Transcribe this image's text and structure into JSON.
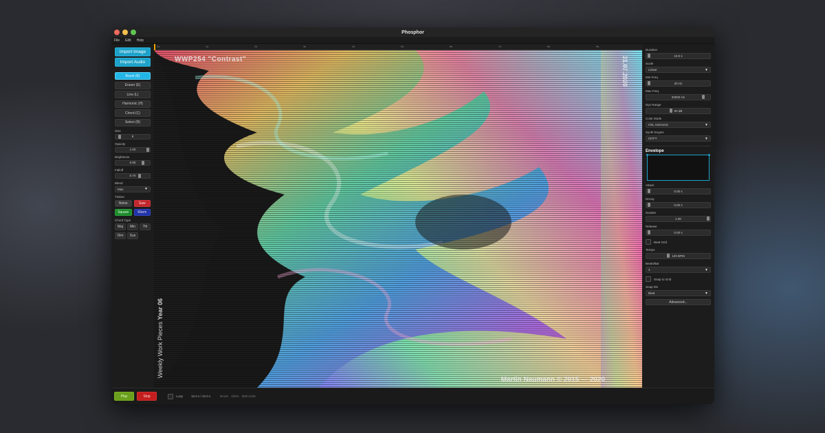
{
  "window": {
    "title": "Phosphor"
  },
  "menu": [
    "File",
    "Edit",
    "Help"
  ],
  "left": {
    "import_image": "Import Image",
    "import_audio": "Import Audio",
    "tools": [
      "Brush (B)",
      "Eraser (E)",
      "Line (L)",
      "Harmonic (H)",
      "Chord (C)",
      "Select (R)"
    ],
    "active_tool": "Brush (B)",
    "size": {
      "label": "Size",
      "value": "8"
    },
    "opacity": {
      "label": "Opacity",
      "value": "1.00"
    },
    "brightness": {
      "label": "Brightness",
      "value": "0.80"
    },
    "falloff": {
      "label": "Falloff",
      "value": "0.70"
    },
    "blend": {
      "label": "Blend",
      "value": "Max"
    },
    "timbre": {
      "label": "Timbre",
      "options": [
        "Noise",
        "Saw",
        "Square",
        "Warm"
      ]
    },
    "chord": {
      "label": "Chord Type",
      "options": [
        "Maj",
        "Min",
        "7th",
        "Dim",
        "Sus"
      ]
    }
  },
  "ruler": {
    "ticks": [
      "0s",
      "1s",
      "2s",
      "3s",
      "4s",
      "5s",
      "6s",
      "7s",
      "8s",
      "9s"
    ]
  },
  "canvas_text": {
    "title": "WWP254 \"Contrast\"",
    "date": "31.07.2020",
    "series_prefix": "Weekly Work Pieces",
    "series_bold": "Year 06",
    "credit": "Martin Naumann © 2015 — 2020",
    "logo": "C"
  },
  "right": {
    "duration": {
      "label": "Duration",
      "value": "10.0 s"
    },
    "scale": {
      "label": "Scale",
      "value": "Linear"
    },
    "min_freq": {
      "label": "Min Freq",
      "value": "20 Hz"
    },
    "max_freq": {
      "label": "Max Freq",
      "value": "20000 Hz"
    },
    "dyn_range": {
      "label": "Dyn Range",
      "value": "60 dB"
    },
    "color_mode": {
      "label": "Color Mode",
      "value": "HSL Harmonic"
    },
    "synth_engine": {
      "label": "Synth Engine",
      "value": "ISTFT"
    },
    "envelope_title": "Envelope",
    "attack": {
      "label": "Attack",
      "value": "0.00 s"
    },
    "decay": {
      "label": "Decay",
      "value": "0.00 s"
    },
    "sustain": {
      "label": "Sustain",
      "value": "1.00"
    },
    "release": {
      "label": "Release",
      "value": "0.00 s"
    },
    "beat_grid": "Beat Grid",
    "tempo": {
      "label": "Tempo",
      "value": "120 BPM"
    },
    "beats_bar": {
      "label": "Beats/Bar",
      "value": "4"
    },
    "snap_to_grid": "Snap to Grid",
    "snap_div": {
      "label": "Snap Div",
      "value": "Beat"
    },
    "advanced": "Advanced..."
  },
  "bottom": {
    "play": "Play",
    "stop": "Stop",
    "loop": "Loop",
    "time": "10.0 s / 10.0 s",
    "tool": "Brush",
    "zoom": "100%",
    "size": "858×1025"
  },
  "colors": {
    "accent": "#1ea2c9",
    "play": "#6a9e1c",
    "stop": "#c41d1d"
  }
}
